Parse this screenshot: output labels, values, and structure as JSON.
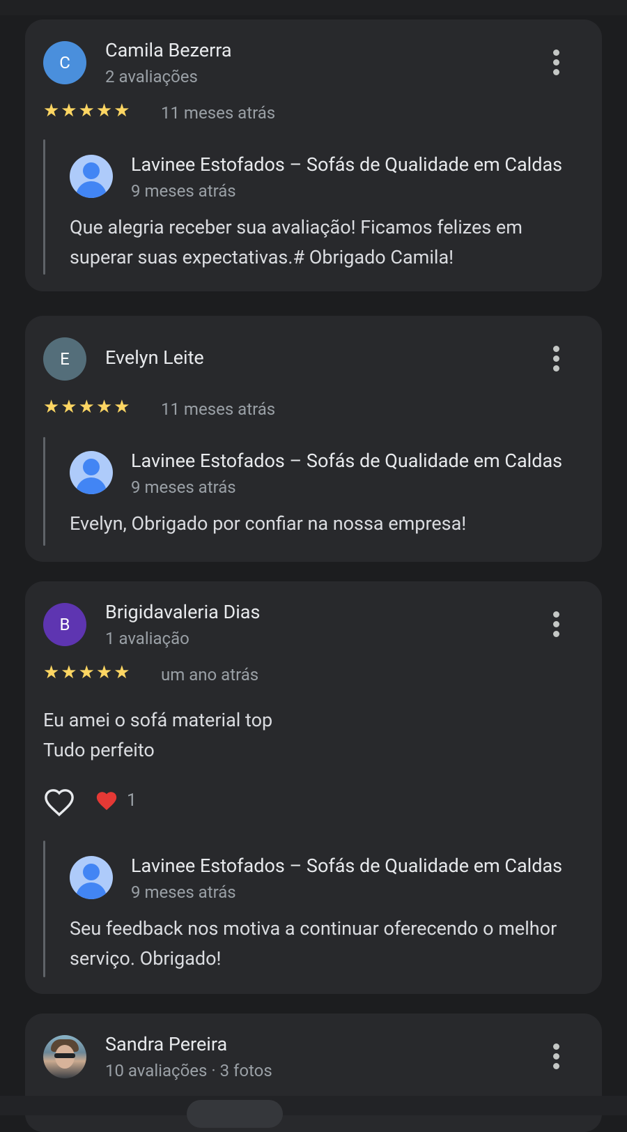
{
  "reviews": [
    {
      "initial": "C",
      "avatar_color": "#4a8fdc",
      "name": "Camila Bezerra",
      "meta": "2 avaliações",
      "stars": "★★★★★",
      "ago": "11 meses atrás",
      "reply": {
        "business": "Lavinee Estofados – Sofás de Qualidade em Caldas",
        "ago": "9 meses atrás",
        "text": "Que alegria receber sua avaliação! Ficamos felizes em superar suas expectativas.# Obrigado Camila!"
      }
    },
    {
      "initial": "E",
      "avatar_color": "#546e7a",
      "name": "Evelyn Leite",
      "stars": "★★★★★",
      "ago": "11 meses atrás",
      "reply": {
        "business": "Lavinee Estofados – Sofás de Qualidade em Caldas",
        "ago": "9 meses atrás",
        "text": "Evelyn, Obrigado por confiar na nossa empresa!"
      }
    },
    {
      "initial": "B",
      "avatar_color": "#5e35b1",
      "name": "Brigidavaleria Dias",
      "meta": "1 avaliação",
      "stars": "★★★★★",
      "ago": "um ano atrás",
      "text_line1": "Eu amei o sofá material top",
      "text_line2": "Tudo perfeito",
      "like_reaction": "❤️",
      "like_count": "1",
      "reply": {
        "business": "Lavinee Estofados – Sofás de Qualidade em Caldas",
        "ago": "9 meses atrás",
        "text": "Seu feedback nos motiva a continuar oferecendo o melhor serviço. Obrigado!"
      }
    },
    {
      "name": "Sandra Pereira",
      "meta": "10 avaliações · 3 fotos"
    }
  ],
  "icons": {
    "more": "more-vert-icon",
    "like": "heart-outline-icon",
    "reaction": "red-heart-icon"
  }
}
